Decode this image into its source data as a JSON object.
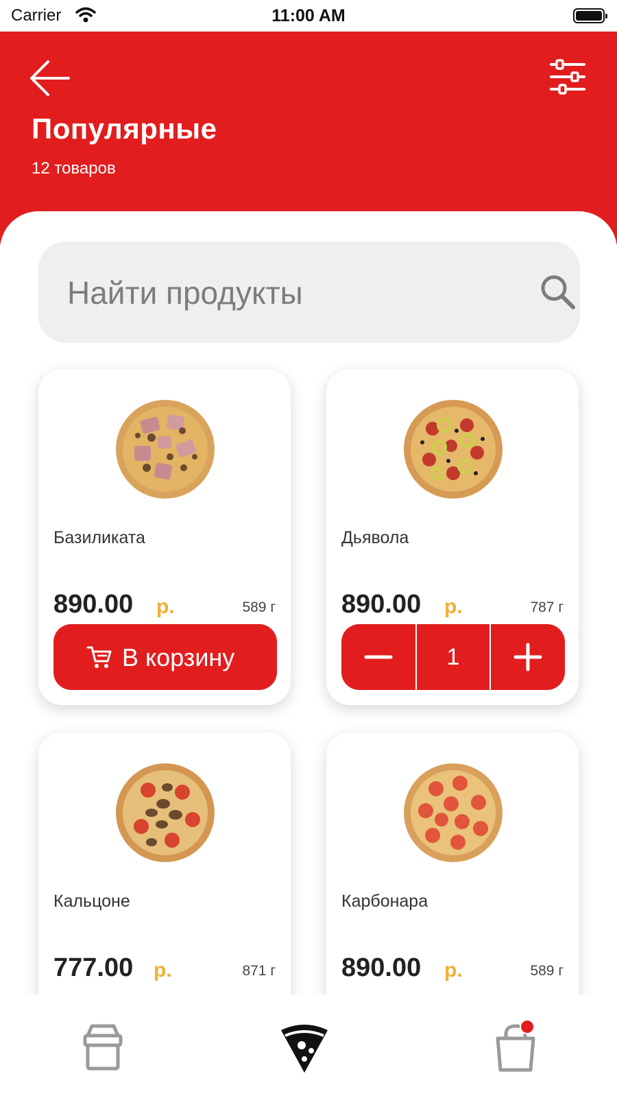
{
  "status_bar": {
    "carrier": "Carrier",
    "time": "11:00 AM"
  },
  "header": {
    "title": "Популярные",
    "subtitle": "12 товаров",
    "background_color": "#e21d1e"
  },
  "search": {
    "placeholder": "Найти продукты"
  },
  "colors": {
    "accent": "#e21d1e",
    "currency": "#f2b035",
    "search_bg": "#efefef"
  },
  "products": [
    {
      "name": "Базиликата",
      "price": "890.00",
      "currency": "р.",
      "weight": "589 г",
      "action": "В корзину"
    },
    {
      "name": "Дьявола",
      "price": "890.00",
      "currency": "р.",
      "weight": "787 г",
      "quantity": "1"
    },
    {
      "name": "Кальцоне",
      "price": "777.00",
      "currency": "р.",
      "weight": "871 г"
    },
    {
      "name": "Карбонара",
      "price": "890.00",
      "currency": "р.",
      "weight": "589 г"
    }
  ],
  "tab_bar": {
    "items": [
      "store-icon",
      "pizza-slice-icon",
      "shopping-bag-icon"
    ],
    "active": "pizza-slice-icon",
    "cart_badge": true
  }
}
